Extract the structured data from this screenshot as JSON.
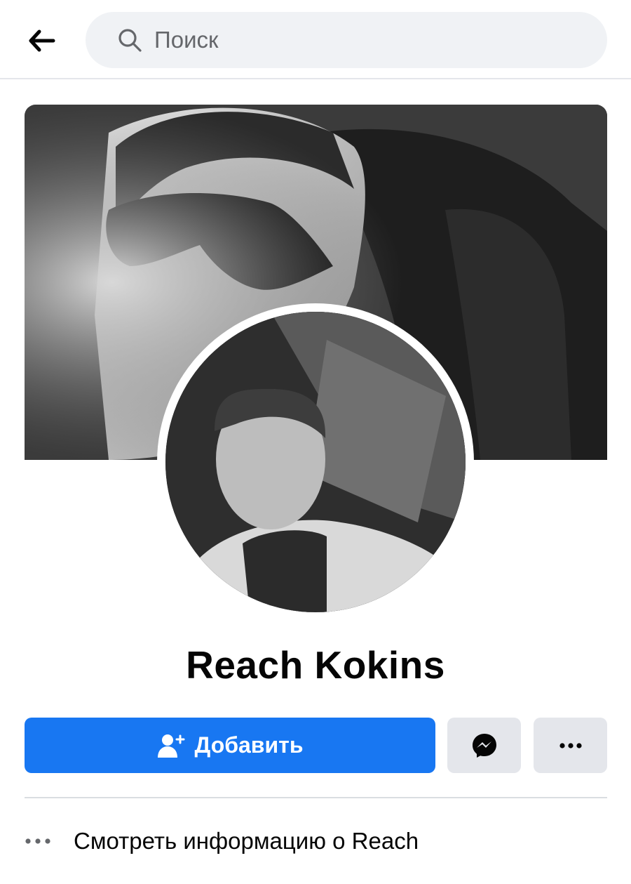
{
  "search": {
    "placeholder": "Поиск"
  },
  "profile": {
    "name": "Reach Kokins",
    "cover_photo": "cover-photo",
    "avatar_photo": "profile-photo"
  },
  "actions": {
    "add_label": "Добавить",
    "add_icon": "add-friend-icon",
    "message_icon": "messenger-icon",
    "more_icon": "more-dots-icon"
  },
  "info": {
    "label": "Смотреть информацию о Reach",
    "icon": "more-dots-icon"
  },
  "colors": {
    "primary": "#1877f2",
    "secondary_button": "#e4e6eb",
    "search_bg": "#f0f2f5",
    "text": "#050505",
    "muted": "#65676b"
  }
}
